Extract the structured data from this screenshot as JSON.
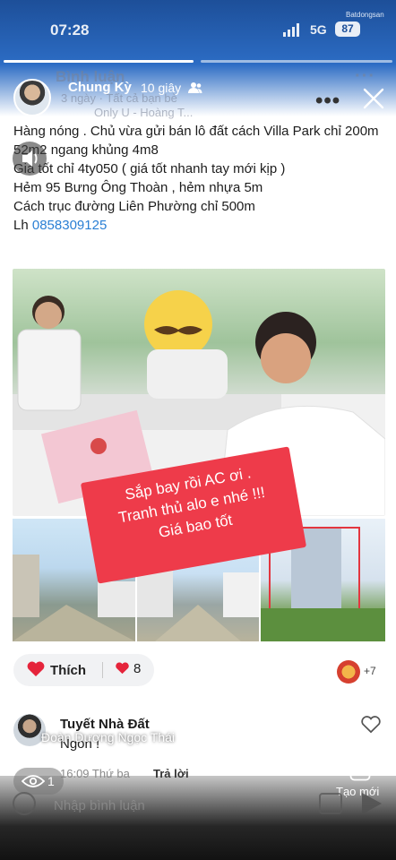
{
  "status": {
    "time": "07:28",
    "network": "5G",
    "battery": "87",
    "watermark": "Batdongsan"
  },
  "background_header": {
    "title": "Bình luận",
    "meta": "3 ngày · Tất cả bạn bè",
    "sub": "Only U - Hoàng T..."
  },
  "story": {
    "author": "Chung Kỳ",
    "time_ago": "10 giây"
  },
  "post": {
    "lines": [
      "Hàng nóng . Chủ vừa gửi bán lô đất cách Villa Park chỉ 200m",
      "52m2 ngang khủng 4m8",
      "Giá tốt chỉ 4ty050 ( giá tốt nhanh tay mới kịp )",
      "Hẻm 95 Bưng Ông Thoàn , hẻm nhựa 5m",
      "Cách trục đường Liên Phường chỉ 500m"
    ],
    "contact_prefix": "Lh ",
    "phone": "0858309125"
  },
  "image_sticker": {
    "line1": "Sắp bay rồi AC ơi .",
    "line2": "Tranh thủ alo e nhé !!!",
    "line3": "Giá bao tốt"
  },
  "reactions": {
    "like_label": "Thích",
    "like_count": "8",
    "others": "+7"
  },
  "comment": {
    "author": "Tuyết Nhà Đất",
    "text": "Ngon !",
    "overlay_name": "Đoàn Dương Ngọc Thái",
    "time": "16:09 Thứ ba",
    "reply_label": "Trả lời"
  },
  "footer": {
    "views": "1",
    "create_label": "Tạo mới",
    "input_placeholder": "Nhập bình luận"
  },
  "colors": {
    "accent_blue": "#2a7fd4",
    "sticker_red": "#ee3b4a",
    "heart_red": "#e5243b"
  }
}
